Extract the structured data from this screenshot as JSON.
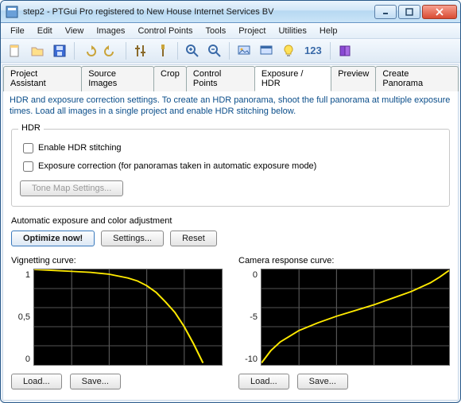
{
  "window_title": "step2 - PTGui Pro registered to New House Internet Services BV",
  "menu": [
    "File",
    "Edit",
    "View",
    "Images",
    "Control Points",
    "Tools",
    "Project",
    "Utilities",
    "Help"
  ],
  "toolbar": {
    "ruler_num": "123"
  },
  "tabs": [
    "Project Assistant",
    "Source Images",
    "Crop",
    "Control Points",
    "Exposure / HDR",
    "Preview",
    "Create Panorama"
  ],
  "active_tab": "Exposure / HDR",
  "info_text": "HDR and exposure correction settings. To create an HDR panorama, shoot the full panorama at multiple exposure times. Load all images in a single project and enable HDR stitching below.",
  "hdr": {
    "legend": "HDR",
    "enable_label": "Enable HDR stitching",
    "expo_label": "Exposure correction (for panoramas taken in automatic exposure mode)",
    "tonemap_label": "Tone Map Settings..."
  },
  "auto": {
    "title": "Automatic exposure and color adjustment",
    "optimize": "Optimize now!",
    "settings": "Settings...",
    "reset": "Reset"
  },
  "vign": {
    "title": "Vignetting curve:",
    "yticks": [
      "1",
      "0,5",
      "0"
    ],
    "load": "Load...",
    "save": "Save..."
  },
  "cam": {
    "title": "Camera response curve:",
    "yticks": [
      "0",
      "-5",
      "-10"
    ],
    "load": "Load...",
    "save": "Save..."
  },
  "chart_data": [
    {
      "type": "line",
      "title": "Vignetting curve",
      "xlabel": "",
      "ylabel": "",
      "ylim": [
        0,
        1
      ],
      "x": [
        0.0,
        0.1,
        0.2,
        0.3,
        0.4,
        0.45,
        0.5,
        0.55,
        0.6,
        0.65,
        0.7,
        0.75,
        0.8,
        0.85,
        0.9
      ],
      "values": [
        1.0,
        0.99,
        0.98,
        0.97,
        0.95,
        0.93,
        0.91,
        0.88,
        0.83,
        0.76,
        0.66,
        0.55,
        0.4,
        0.22,
        0.02
      ]
    },
    {
      "type": "line",
      "title": "Camera response curve",
      "xlabel": "",
      "ylabel": "",
      "ylim": [
        -10,
        0
      ],
      "x": [
        0.0,
        0.05,
        0.1,
        0.15,
        0.2,
        0.3,
        0.4,
        0.5,
        0.6,
        0.7,
        0.8,
        0.9,
        0.95,
        1.0
      ],
      "values": [
        -9.8,
        -8.5,
        -7.6,
        -7.0,
        -6.4,
        -5.6,
        -4.9,
        -4.3,
        -3.7,
        -3.0,
        -2.3,
        -1.4,
        -0.8,
        -0.1
      ]
    }
  ]
}
